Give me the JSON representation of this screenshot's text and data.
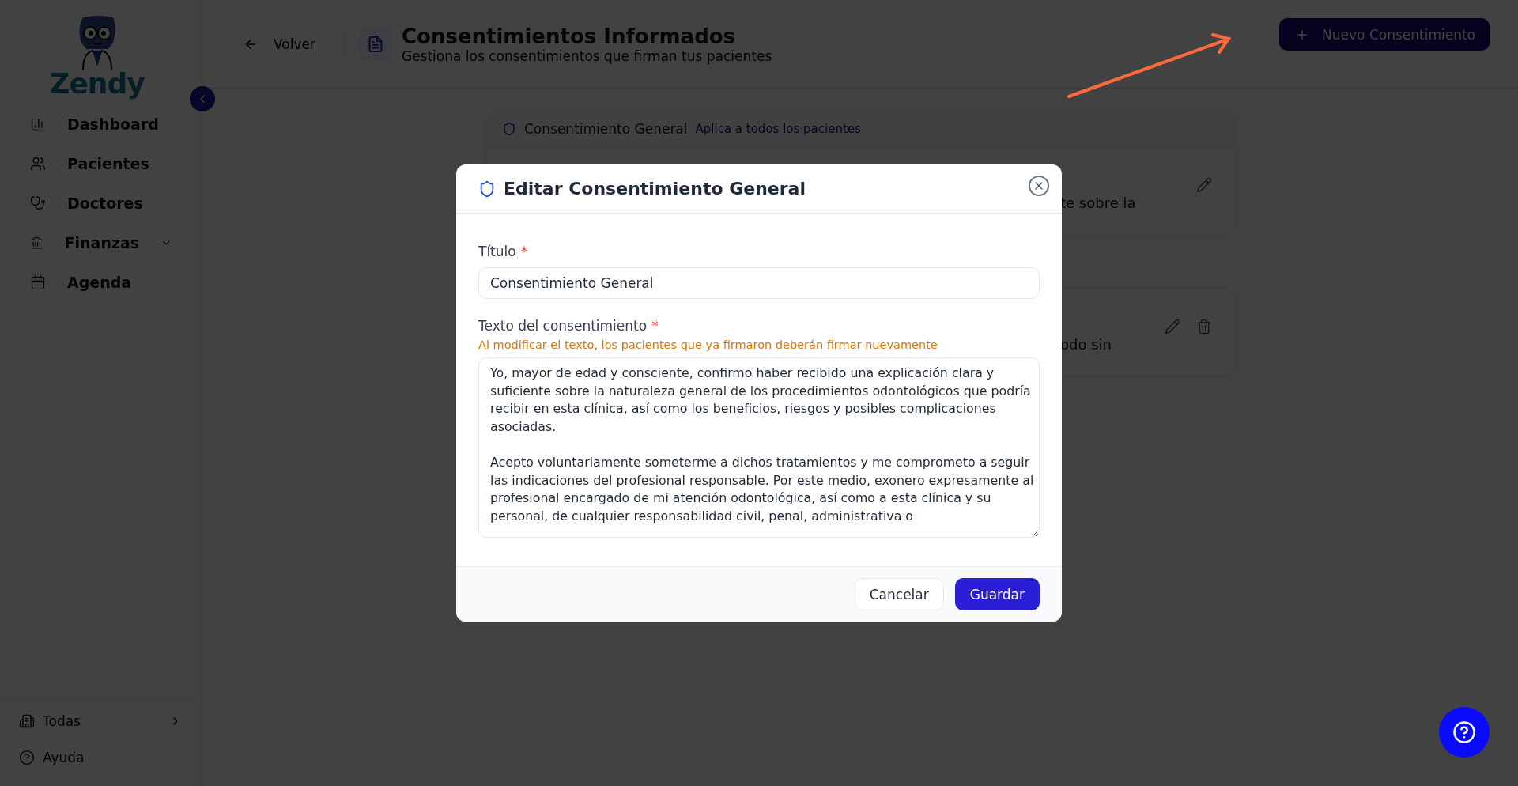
{
  "sidebar": {
    "logo_text": "Zendy",
    "items": [
      {
        "label": "Dashboard",
        "has_submenu": false
      },
      {
        "label": "Pacientes",
        "has_submenu": false
      },
      {
        "label": "Doctores",
        "has_submenu": false
      },
      {
        "label": "Finanzas",
        "has_submenu": true
      },
      {
        "label": "Agenda",
        "has_submenu": false
      }
    ],
    "footer_items": [
      {
        "label": "Todas",
        "has_submenu": true
      },
      {
        "label": "Ayuda",
        "has_submenu": false
      }
    ]
  },
  "header": {
    "back_label": "Volver",
    "title": "Consentimientos Informados",
    "subtitle": "Gestiona los consentimientos que firman tus pacientes",
    "new_button": "Nuevo Consentimiento"
  },
  "cards": [
    {
      "title": "Consentimiento General",
      "scope": "Aplica a todos los pacientes",
      "fragment": "te sobre la",
      "deletable": false
    },
    {
      "fragment": "odo sin",
      "deletable": true
    }
  ],
  "modal": {
    "title": "Editar Consentimiento General",
    "fields": [
      {
        "kind": "input",
        "label": "Título",
        "required_mark": "*",
        "value": "Consentimiento General"
      },
      {
        "kind": "textarea",
        "label": "Texto del consentimiento",
        "required_mark": "*",
        "hint": "Al modificar el texto, los pacientes que ya firmaron deberán firmar nuevamente",
        "value": "Yo, mayor de edad y consciente, confirmo haber recibido una explicación clara y suficiente sobre la naturaleza general de los procedimientos odontológicos que podría recibir en esta clínica, así como los beneficios, riesgos y posibles complicaciones asociadas.\n\nAcepto voluntariamente someterme a dichos tratamientos y me comprometo a seguir las indicaciones del profesional responsable. Por este medio, exonero expresamente al profesional encargado de mi atención odontológica, así como a esta clínica y su personal, de cualquier responsabilidad civil, penal, administrativa o"
      }
    ],
    "buttons": [
      {
        "label": "Cancelar",
        "primary": false
      },
      {
        "label": "Guardar",
        "primary": true
      }
    ]
  }
}
